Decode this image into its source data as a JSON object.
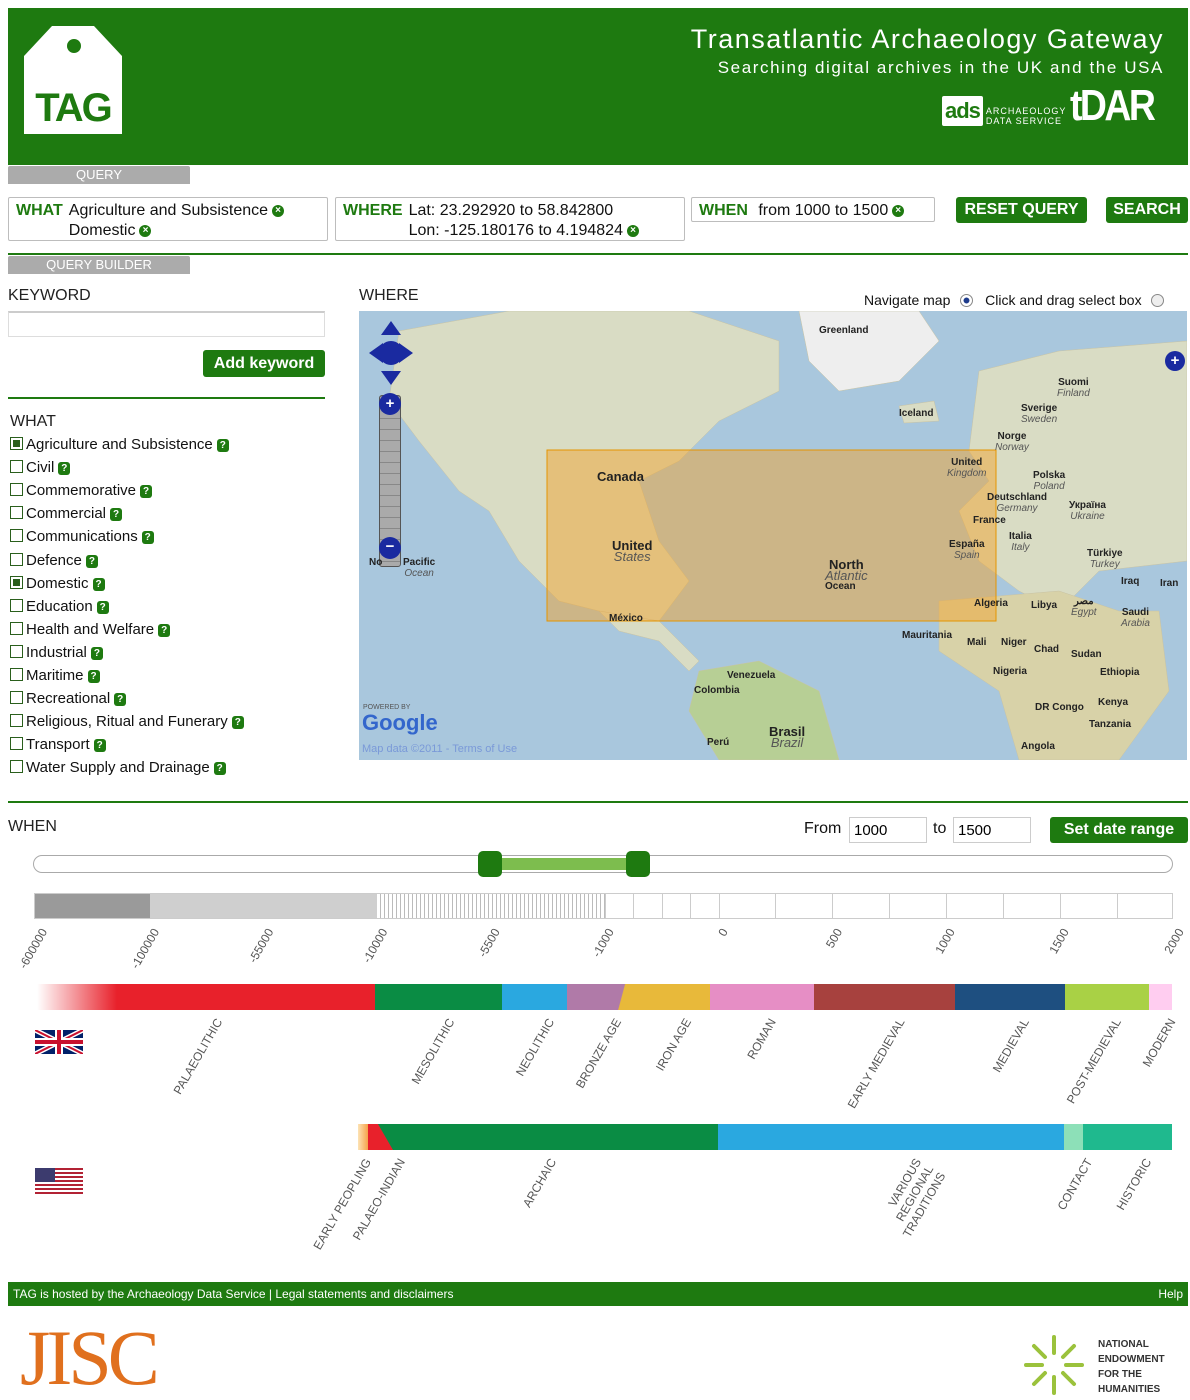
{
  "header": {
    "logo_text": "TAG",
    "title": "Transatlantic Archaeology Gateway",
    "subtitle": "Searching digital archives in the UK and the USA",
    "ads_logo": "ads",
    "ads_sub_line1": "ARCHAEOLOGY",
    "ads_sub_line2": "DATA SERVICE",
    "tdar_logo": "tDAR",
    "brand_color": "#1e7a10"
  },
  "query": {
    "tab_label": "QUERY",
    "what_label": "WHAT",
    "what_values": [
      "Agriculture and Subsistence",
      "Domestic"
    ],
    "where_label": "WHERE",
    "where_lat": "Lat: 23.292920 to 58.842800",
    "where_lon": "Lon: -125.180176 to 4.194824",
    "when_label": "WHEN",
    "when_value": "from 1000 to 1500",
    "reset_label": "RESET QUERY",
    "search_label": "SEARCH"
  },
  "builder": {
    "tab_label": "QUERY BUILDER",
    "keyword_heading": "KEYWORD",
    "keyword_value": "",
    "add_keyword_label": "Add keyword",
    "what_heading": "WHAT",
    "what_items": [
      {
        "label": "Agriculture and Subsistence",
        "checked": true
      },
      {
        "label": "Civil",
        "checked": false
      },
      {
        "label": "Commemorative",
        "checked": false
      },
      {
        "label": "Commercial",
        "checked": false
      },
      {
        "label": "Communications",
        "checked": false
      },
      {
        "label": "Defence",
        "checked": false
      },
      {
        "label": "Domestic",
        "checked": true
      },
      {
        "label": "Education",
        "checked": false
      },
      {
        "label": "Health and Welfare",
        "checked": false
      },
      {
        "label": "Industrial",
        "checked": false
      },
      {
        "label": "Maritime",
        "checked": false
      },
      {
        "label": "Recreational",
        "checked": false
      },
      {
        "label": "Religious, Ritual and Funerary",
        "checked": false
      },
      {
        "label": "Transport",
        "checked": false
      },
      {
        "label": "Water Supply and Drainage",
        "checked": false
      }
    ]
  },
  "map": {
    "heading": "WHERE",
    "mode_navigate": "Navigate map",
    "mode_select": "Click and drag select box",
    "selected_mode": "navigate",
    "powered_by": "POWERED BY",
    "google": "Google",
    "map_data": "Map data ©2011",
    "separator": " - ",
    "terms": "Terms of Use",
    "labels": [
      {
        "name": "Greenland",
        "sub": ""
      },
      {
        "name": "Iceland",
        "sub": ""
      },
      {
        "name": "Suomi",
        "sub": "Finland"
      },
      {
        "name": "Sverige",
        "sub": "Sweden"
      },
      {
        "name": "Norge",
        "sub": "Norway"
      },
      {
        "name": "United",
        "sub": "Kingdom"
      },
      {
        "name": "Polska",
        "sub": "Poland"
      },
      {
        "name": "Deutschland",
        "sub": "Germany"
      },
      {
        "name": "Україна",
        "sub": "Ukraine"
      },
      {
        "name": "France",
        "sub": ""
      },
      {
        "name": "Italia",
        "sub": "Italy"
      },
      {
        "name": "España",
        "sub": "Spain"
      },
      {
        "name": "Türkiye",
        "sub": "Turkey"
      },
      {
        "name": "Canada",
        "sub": ""
      },
      {
        "name": "United",
        "sub": "States"
      },
      {
        "name": "North",
        "sub": "Atlantic"
      },
      {
        "name": "Ocean",
        "sub": ""
      },
      {
        "name": "No",
        "sub": ""
      },
      {
        "name": "Pacific",
        "sub": "Ocean"
      },
      {
        "name": "México",
        "sub": ""
      },
      {
        "name": "Algeria",
        "sub": ""
      },
      {
        "name": "Libya",
        "sub": ""
      },
      {
        "name": "مصر",
        "sub": "Egypt"
      },
      {
        "name": "Iraq",
        "sub": ""
      },
      {
        "name": "Iran",
        "sub": ""
      },
      {
        "name": "Saudi",
        "sub": "Arabia"
      },
      {
        "name": "Mauritania",
        "sub": ""
      },
      {
        "name": "Mali",
        "sub": ""
      },
      {
        "name": "Niger",
        "sub": ""
      },
      {
        "name": "Chad",
        "sub": ""
      },
      {
        "name": "Sudan",
        "sub": ""
      },
      {
        "name": "Nigeria",
        "sub": ""
      },
      {
        "name": "Ethiopia",
        "sub": ""
      },
      {
        "name": "Venezuela",
        "sub": ""
      },
      {
        "name": "Colombia",
        "sub": ""
      },
      {
        "name": "Kenya",
        "sub": ""
      },
      {
        "name": "DR Congo",
        "sub": ""
      },
      {
        "name": "Tanzania",
        "sub": ""
      },
      {
        "name": "Perú",
        "sub": ""
      },
      {
        "name": "Brasil",
        "sub": "Brazil"
      },
      {
        "name": "Angola",
        "sub": ""
      }
    ]
  },
  "when": {
    "heading": "WHEN",
    "from_label": "From",
    "from_value": "1000",
    "to_label": "to",
    "to_value": "1500",
    "set_label": "Set date range",
    "slider_from_fraction": 0.4,
    "slider_to_fraction": 0.53,
    "axis_ticks": [
      "-600000",
      "-100000",
      "-55000",
      "-10000",
      "-5500",
      "-1000",
      "0",
      "500",
      "1000",
      "1500",
      "2000"
    ],
    "uk_periods": [
      {
        "label": "PALAEOLITHIC",
        "color": "#e8212b"
      },
      {
        "label": "MESOLITHIC",
        "color": "#0a8c44"
      },
      {
        "label": "NEOLITHIC",
        "color": "#2aa8e0"
      },
      {
        "label": "BRONZE AGE",
        "color": "#b07aa8"
      },
      {
        "label": "IRON AGE",
        "color": "#e8b93a"
      },
      {
        "label": "ROMAN",
        "color": "#e68ec5"
      },
      {
        "label": "EARLY MEDIEVAL",
        "color": "#a7413e"
      },
      {
        "label": "MEDIEVAL",
        "color": "#1e4f80"
      },
      {
        "label": "POST-MEDIEVAL",
        "color": "#a9d145"
      },
      {
        "label": "MODERN",
        "color": "#ffcdf0"
      }
    ],
    "us_periods": [
      {
        "label": "EARLY PEOPLING",
        "color": "#f6a24a"
      },
      {
        "label": "PALAEO-INDIAN",
        "color": "#e8212b"
      },
      {
        "label": "ARCHAIC",
        "color": "#0a8c44"
      },
      {
        "label": "VARIOUS REGIONAL TRADITIONS",
        "color": "#2aa8e0"
      },
      {
        "label": "CONTACT",
        "color": "#8de0b8"
      },
      {
        "label": "HISTORIC",
        "color": "#1fb98e"
      }
    ]
  },
  "footer": {
    "text": "TAG is hosted by the Archaeology Data Service | Legal statements and disclaimers",
    "help": "Help",
    "jisc": "JISC",
    "neh_line1": "NATIONAL",
    "neh_line2": "ENDOWMENT",
    "neh_line3": "FOR THE",
    "neh_line4": "HUMANITIES"
  }
}
